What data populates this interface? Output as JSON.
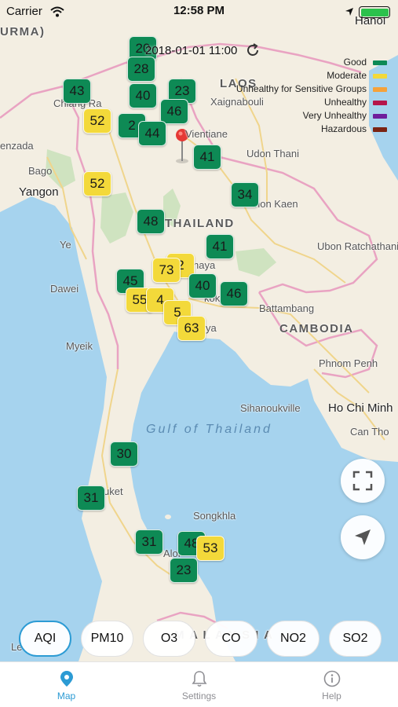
{
  "status_bar": {
    "carrier": "Carrier",
    "time": "12:58 PM"
  },
  "map": {
    "timestamp": "2018-01-01 11:00",
    "places": [
      {
        "id": "burma",
        "text": "URMA)"
      },
      {
        "id": "hanoi",
        "text": "Hanoi"
      },
      {
        "id": "laos",
        "text": "LAOS"
      },
      {
        "id": "xaignabouli",
        "text": "Xaignabouli"
      },
      {
        "id": "chiang",
        "text": "Chiang Ra"
      },
      {
        "id": "vientiane",
        "text": "Vientiane"
      },
      {
        "id": "enzada",
        "text": "enzada"
      },
      {
        "id": "udon",
        "text": "Udon Thani"
      },
      {
        "id": "bago",
        "text": "Bago"
      },
      {
        "id": "yangon",
        "text": "Yangon"
      },
      {
        "id": "khonkaen",
        "text": "hon Kaen"
      },
      {
        "id": "thailand",
        "text": "THAILAND"
      },
      {
        "id": "ye",
        "text": "Ye"
      },
      {
        "id": "ubon",
        "text": "Ubon Ratchathani"
      },
      {
        "id": "ayutthaya",
        "text": "haya"
      },
      {
        "id": "dawei",
        "text": "Dawei"
      },
      {
        "id": "bangkok",
        "text": "kok"
      },
      {
        "id": "battambang",
        "text": "Battambang"
      },
      {
        "id": "cambodia",
        "text": "CAMBODIA"
      },
      {
        "id": "pattaya",
        "text": "ya"
      },
      {
        "id": "myeik",
        "text": "Myeik"
      },
      {
        "id": "phnompenh",
        "text": "Phnom Penh"
      },
      {
        "id": "sihanoukville",
        "text": "Sihanoukville"
      },
      {
        "id": "hochiminh",
        "text": "Ho Chi Minh"
      },
      {
        "id": "canthor",
        "text": "Can Tho"
      },
      {
        "id": "gulf",
        "text": "Gulf of Thailand"
      },
      {
        "id": "phuket",
        "text": "uket"
      },
      {
        "id": "songkhla",
        "text": "Songkhla"
      },
      {
        "id": "alor",
        "text": "Alor"
      },
      {
        "id": "malaysia",
        "text": "M A L A Y S I A"
      },
      {
        "id": "legal",
        "text": "Le"
      }
    ],
    "markers": [
      {
        "value": "43",
        "level": "good"
      },
      {
        "value": "20",
        "level": "good"
      },
      {
        "value": "28",
        "level": "good"
      },
      {
        "value": "40",
        "level": "good"
      },
      {
        "value": "23",
        "level": "good"
      },
      {
        "value": "46",
        "level": "good"
      },
      {
        "value": "52",
        "level": "moderate"
      },
      {
        "value": "2",
        "level": "good"
      },
      {
        "value": "44",
        "level": "good"
      },
      {
        "value": "41",
        "level": "good"
      },
      {
        "value": "52",
        "level": "moderate"
      },
      {
        "value": "34",
        "level": "good"
      },
      {
        "value": "48",
        "level": "good"
      },
      {
        "value": "41",
        "level": "good"
      },
      {
        "value": "2",
        "level": "moderate"
      },
      {
        "value": "73",
        "level": "moderate"
      },
      {
        "value": "45",
        "level": "good"
      },
      {
        "value": "40",
        "level": "good"
      },
      {
        "value": "46",
        "level": "good"
      },
      {
        "value": "55",
        "level": "moderate"
      },
      {
        "value": "4",
        "level": "moderate"
      },
      {
        "value": "5",
        "level": "moderate"
      },
      {
        "value": "63",
        "level": "moderate"
      },
      {
        "value": "30",
        "level": "good"
      },
      {
        "value": "31",
        "level": "good"
      },
      {
        "value": "31",
        "level": "good"
      },
      {
        "value": "48",
        "level": "good"
      },
      {
        "value": "53",
        "level": "moderate"
      },
      {
        "value": "23",
        "level": "good"
      }
    ]
  },
  "legend": {
    "items": [
      {
        "label": "Good",
        "color": "#0e8a55"
      },
      {
        "label": "Moderate",
        "color": "#f3d93a"
      },
      {
        "label": "Unhealthy for Sensitive Groups",
        "color": "#f5a23a"
      },
      {
        "label": "Unhealthy",
        "color": "#b5154b"
      },
      {
        "label": "Very Unhealthy",
        "color": "#6f1e9c"
      },
      {
        "label": "Hazardous",
        "color": "#7a2413"
      }
    ]
  },
  "pollutants": [
    "AQI",
    "PM10",
    "O3",
    "CO",
    "NO2",
    "SO2"
  ],
  "selected_pollutant": "AQI",
  "tabs": [
    {
      "label": "Map",
      "icon": "map-pin-icon"
    },
    {
      "label": "Settings",
      "icon": "bell-icon"
    },
    {
      "label": "Help",
      "icon": "info-icon"
    }
  ],
  "colors": {
    "accent": "#2c9bd4",
    "water": "#a6d3ee",
    "land": "#f3eee2",
    "good": "#0e8a55",
    "moderate": "#f3d93a"
  }
}
